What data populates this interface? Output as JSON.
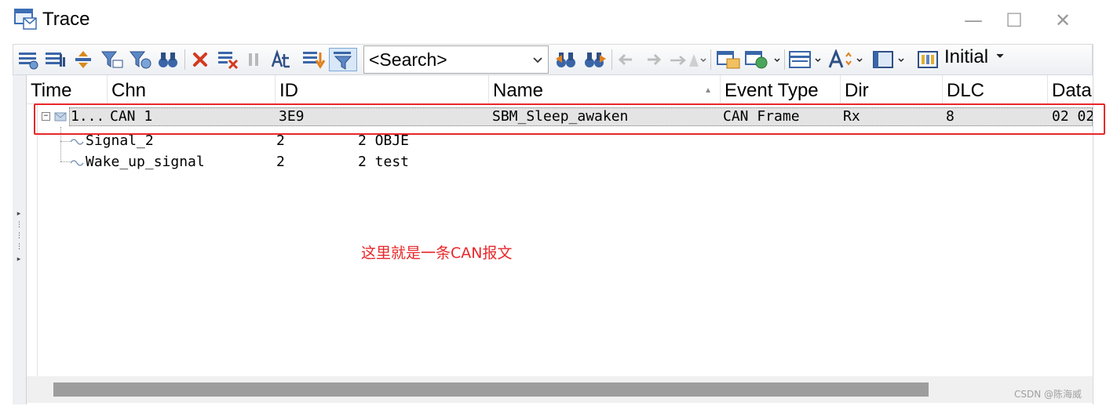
{
  "window": {
    "title": "Trace",
    "minimize": "—",
    "maximize": "☐",
    "close": "✕"
  },
  "toolbar": {
    "search_placeholder": "<Search>",
    "initial_label": "Initial"
  },
  "columns": [
    "Time",
    "Chn",
    "ID",
    "Name",
    "Event Type",
    "Dir",
    "DLC",
    "Data"
  ],
  "message": {
    "time": "1...",
    "chn": "CAN 1",
    "id": "3E9",
    "name": "SBM_Sleep_awaken",
    "event_type": "CAN Frame",
    "dir": "Rx",
    "dlc": "8",
    "data": "02 02"
  },
  "signals": [
    {
      "name": "Signal_2",
      "col2": "2",
      "col3": "2 OBJE"
    },
    {
      "name": "Wake_up_signal",
      "col2": "2",
      "col3": "2 test"
    }
  ],
  "annotation": "这里就是一条CAN报文",
  "watermark": "CSDN @陈海威",
  "colors": {
    "highlight": "#e8272a",
    "selection": "#e4e4e4",
    "scroll_thumb": "#9d9d9d"
  }
}
